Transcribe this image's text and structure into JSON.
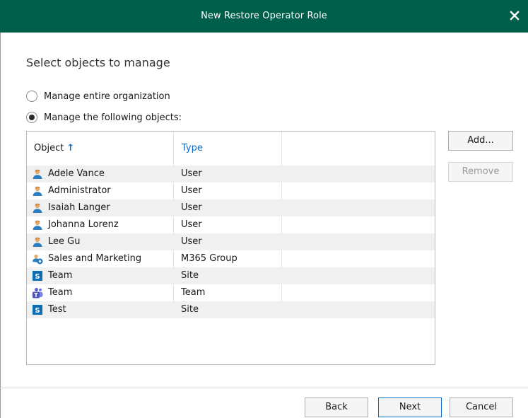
{
  "window": {
    "title": "New Restore Operator Role",
    "close_icon": "close-icon"
  },
  "page": {
    "heading": "Select objects to manage"
  },
  "scope": {
    "options": [
      {
        "label": "Manage entire organization",
        "checked": false
      },
      {
        "label": "Manage the following objects:",
        "checked": true
      }
    ]
  },
  "grid": {
    "columns": {
      "object": "Object",
      "type": "Type"
    },
    "sort_icon": "sort-ascending-icon",
    "rows": [
      {
        "name": "Adele Vance",
        "type": "User",
        "icon": "user-icon"
      },
      {
        "name": "Administrator",
        "type": "User",
        "icon": "user-icon"
      },
      {
        "name": "Isaiah Langer",
        "type": "User",
        "icon": "user-icon"
      },
      {
        "name": "Johanna Lorenz",
        "type": "User",
        "icon": "user-icon"
      },
      {
        "name": "Lee Gu",
        "type": "User",
        "icon": "user-icon"
      },
      {
        "name": "Sales and Marketing",
        "type": "M365 Group",
        "icon": "m365-group-icon"
      },
      {
        "name": "Team",
        "type": "Site",
        "icon": "sharepoint-site-icon"
      },
      {
        "name": "Team",
        "type": "Team",
        "icon": "teams-icon"
      },
      {
        "name": "Test",
        "type": "Site",
        "icon": "sharepoint-site-icon"
      }
    ]
  },
  "side_buttons": {
    "add": "Add...",
    "remove": "Remove"
  },
  "footer": {
    "back": "Back",
    "next": "Next",
    "cancel": "Cancel"
  },
  "colors": {
    "titlebar": "#005f4b",
    "accent": "#0a6ec8"
  }
}
